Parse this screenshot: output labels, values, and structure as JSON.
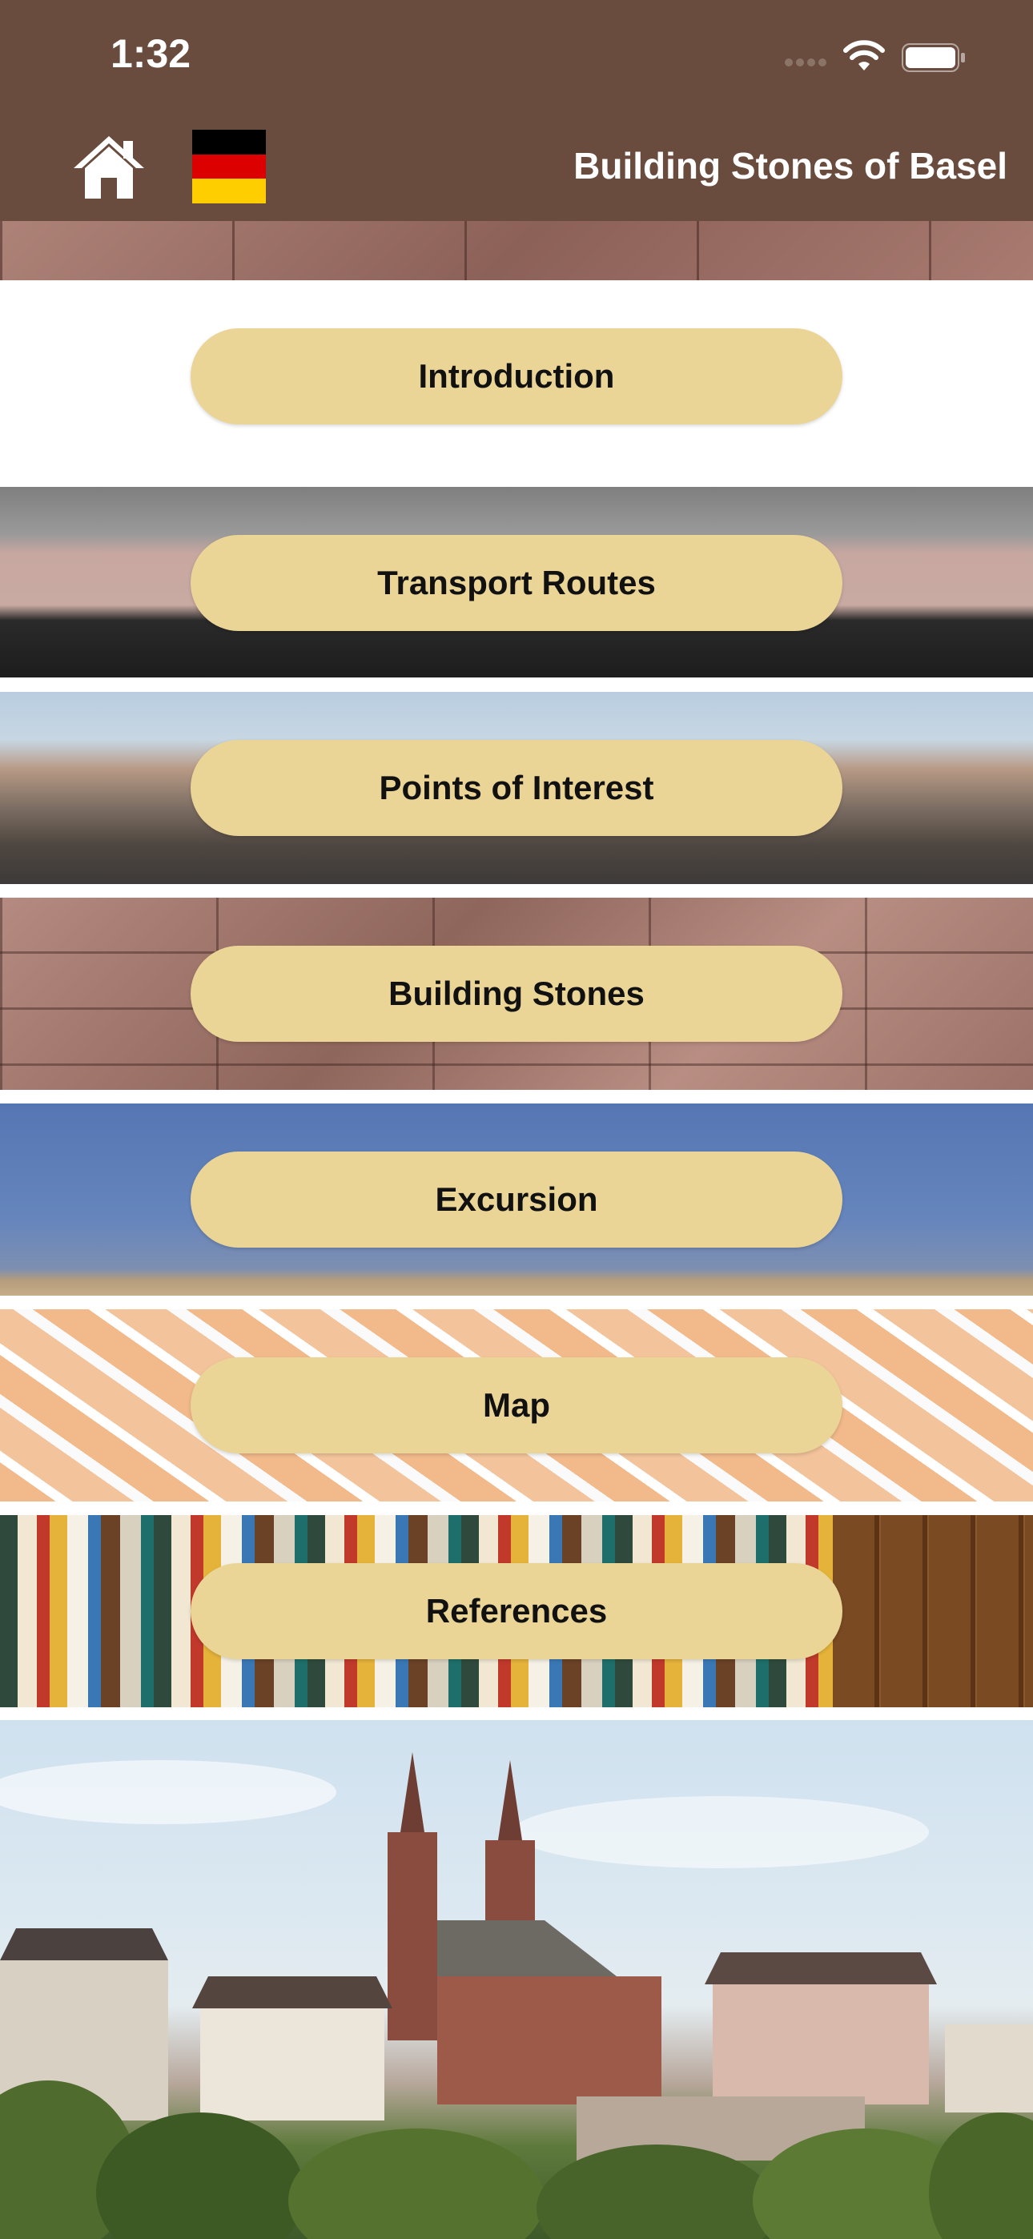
{
  "status_bar": {
    "time": "1:32"
  },
  "header": {
    "title": "Building Stones of Basel",
    "language": "German"
  },
  "icons": {
    "home": "home-icon",
    "flag": "german-flag-icon",
    "wifi": "wifi-icon",
    "battery": "battery-icon"
  },
  "colors": {
    "header_bg": "#6a4c3e",
    "button_bg": "#ead597",
    "button_text": "#111111",
    "flag": [
      "#000000",
      "#dd0000",
      "#ffce00"
    ]
  },
  "menu": [
    {
      "label": "Introduction"
    },
    {
      "label": "Transport Routes"
    },
    {
      "label": "Points of Interest"
    },
    {
      "label": "Building Stones"
    },
    {
      "label": "Excursion"
    },
    {
      "label": "Map"
    },
    {
      "label": "References"
    }
  ]
}
